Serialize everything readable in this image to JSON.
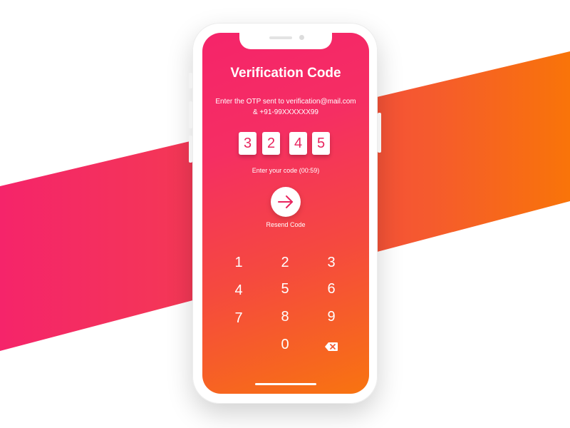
{
  "screen": {
    "title": "Verification Code",
    "subtitle_line1": "Enter the OTP sent to verification@mail.com",
    "subtitle_line2": "& +91-99XXXXXX99",
    "otp_digits": [
      "3",
      "2",
      "4",
      "5"
    ],
    "timer_text": "Enter your code (00:59)",
    "submit_icon": "arrow-right-icon",
    "resend_label": "Resend Code"
  },
  "keypad": {
    "keys": [
      "1",
      "2",
      "3",
      "4",
      "5",
      "6",
      "7",
      "8",
      "9",
      "0"
    ],
    "backspace_icon": "backspace-icon"
  },
  "colors": {
    "gradient_start": "#f5246a",
    "gradient_end": "#f97409",
    "otp_digit": "#e8245e"
  }
}
